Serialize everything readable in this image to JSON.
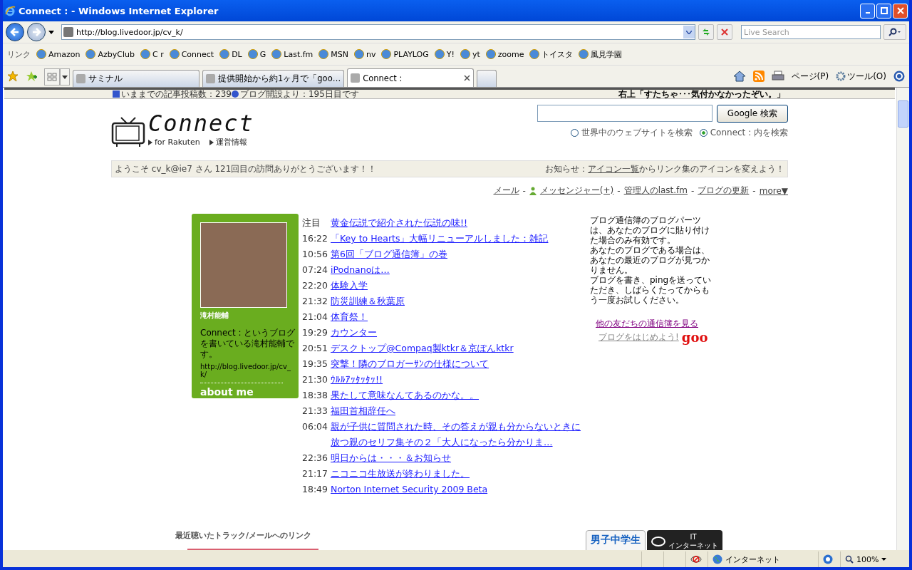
{
  "window": {
    "title": "Connect : - Windows Internet Explorer"
  },
  "address": {
    "url": "http://blog.livedoor.jp/cv_k/",
    "search_placeholder": "Live Search"
  },
  "links_bar": {
    "label": "リンク",
    "items": [
      "Amazon",
      "AzbyClub",
      "C r",
      "Connect",
      "DL",
      "G",
      "Last.fm",
      "MSN",
      "nv",
      "PLAYLOG",
      "Y!",
      "yt",
      "zoome",
      "トイスタ",
      "風見学園"
    ]
  },
  "tabs": [
    {
      "label": "サミナル",
      "selected": false
    },
    {
      "label": "提供開始から約1ヶ月で「goo…",
      "selected": false
    },
    {
      "label": "Connect :",
      "selected": true
    }
  ],
  "command_bar": {
    "page": "ページ(P)",
    "tools": "ツール(O)"
  },
  "page": {
    "ticker": {
      "left_a": "いままでの記事投稿数：239",
      "left_b": "ブログ開設より：195日目です",
      "right": "右上「すたちゃ･･･気付かなかったぞい。」"
    },
    "logo": {
      "title": "Connect",
      "subtitle": "for Rakuten",
      "link": "運営情報"
    },
    "search": {
      "button": "Google 検索",
      "options": [
        {
          "label": "世界中のウェブサイトを検索",
          "selected": false
        },
        {
          "label": "Connect : 内を検索",
          "selected": true
        }
      ]
    },
    "welcome": {
      "text": "ようこそ cv_k@ie7 さん 121回目の訪問ありがとうございます！！",
      "notice_prefix": "お知らせ：",
      "notice_link": "アイコン一覧",
      "notice_suffix": "からリンク集のアイコンを変えよう！"
    },
    "nav": [
      {
        "label": "メール"
      },
      {
        "separator": "-",
        "label": "メッセンジャー(+)"
      },
      {
        "separator": "-",
        "label": "管理人のlast.fm"
      },
      {
        "separator": "-",
        "label": "ブログの更新"
      },
      {
        "separator": "-",
        "label": "more▼"
      }
    ],
    "profile": {
      "name": "滝村能輔",
      "description": "Connect : というブログを書いている滝村能輔です。",
      "url": "http://blog.livedoor.jp/cv_k/",
      "badge": "about me"
    },
    "entries": [
      {
        "time": "注目",
        "title": "黄金伝説で紹介された伝説の味!!"
      },
      {
        "time": "16:22",
        "title": "「Key to Hearts」大幅リニューアルしました：雑記"
      },
      {
        "time": "10:56",
        "title": "第6回「ブログ通信簿」の巻"
      },
      {
        "time": "07:24",
        "title": "iPodnanoは…"
      },
      {
        "time": "22:20",
        "title": "体験入学"
      },
      {
        "time": "21:32",
        "title": "防災訓練＆秋葉原"
      },
      {
        "time": "21:04",
        "title": "体育祭！"
      },
      {
        "time": "19:29",
        "title": "カウンター"
      },
      {
        "time": "20:51",
        "title": "デスクトップ@Compaq製ktkr＆京ぽんktkr"
      },
      {
        "time": "19:35",
        "title": "突撃！隣のブロガーｻﾝの仕様について"
      },
      {
        "time": "21:30",
        "title": "ｳﾙﾙｱｯﾀｯﾀｯ!!"
      },
      {
        "time": "18:38",
        "title": "果たして意味なんてあるのかな。。"
      },
      {
        "time": "21:33",
        "title": "福田首相辞任へ"
      },
      {
        "time": "06:04",
        "title": "親が子供に質問された時、その答えが親も分からないときに放つ親のセリフ集その２「大人になったら分かりま…"
      },
      {
        "time": "22:36",
        "title": "明日からは・・・＆お知らせ"
      },
      {
        "time": "21:17",
        "title": "ニコニコ生放送が終わりました。"
      },
      {
        "time": "18:49",
        "title": "Norton Internet Security 2009 Beta"
      }
    ],
    "report": {
      "paragraphs": [
        "ブログ通信簿のブログパーツは、あなたのブログに貼り付けた場合のみ有効です。",
        "あなたのブログである場合は、あなたの最近のブログが見つかりません。",
        "ブログを書き、pingを送っていただき、しばらくたってからもう一度お試しください。"
      ],
      "friends_link": "他の友だちの通信簿を見る",
      "start_link": "ブログをはじめよう!",
      "brand": "goo"
    },
    "tracks_heading": "最近聴いたトラック/メールへのリンク",
    "banners": [
      "男子中学生",
      "IT",
      "インターネット"
    ]
  },
  "status_bar": {
    "zone": "インターネット",
    "zoom": "100%"
  }
}
